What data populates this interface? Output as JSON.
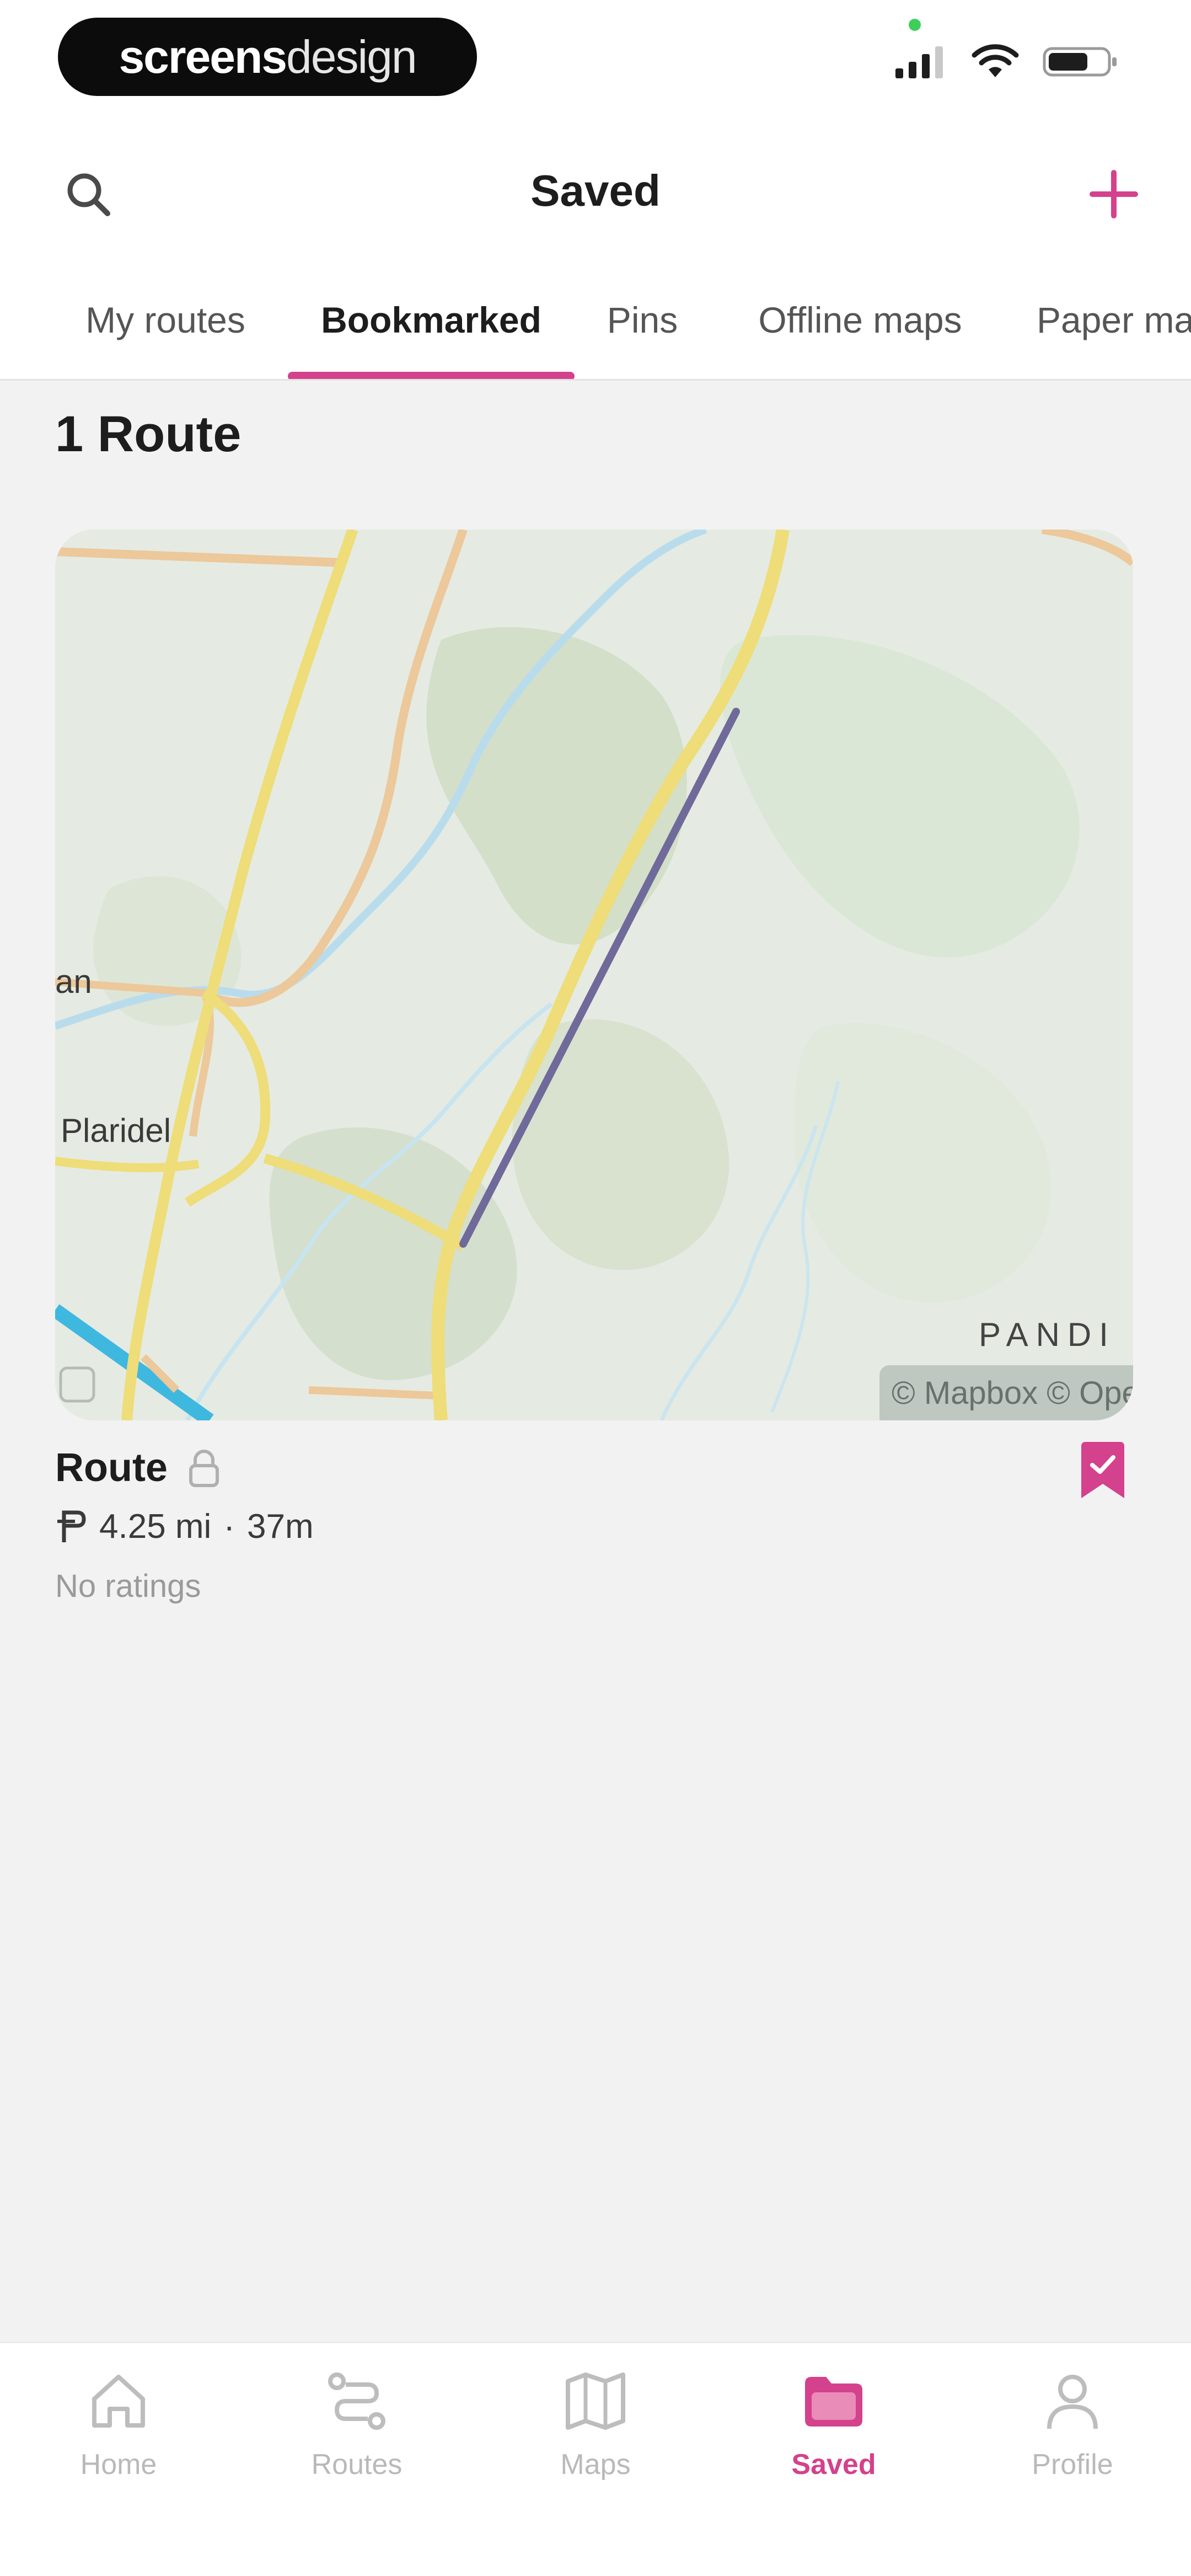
{
  "status_bar": {
    "brand_bold": "screens",
    "brand_light": "design"
  },
  "header": {
    "title": "Saved"
  },
  "tabs": [
    {
      "label": "My routes",
      "active": false
    },
    {
      "label": "Bookmarked",
      "active": true
    },
    {
      "label": "Pins",
      "active": false
    },
    {
      "label": "Offline maps",
      "active": false
    },
    {
      "label": "Paper maps",
      "active": false
    }
  ],
  "content": {
    "count_title": "1 Route",
    "route": {
      "name": "Route",
      "distance": "4.25 mi",
      "separator": "·",
      "duration": "37m",
      "ratings": "No ratings",
      "map": {
        "label_left": "an",
        "label_town": "Plaridel",
        "label_region": "PANDI",
        "attribution": "© Mapbox © OpenStreetMap"
      }
    }
  },
  "bottom_nav": [
    {
      "label": "Home",
      "icon": "home-icon",
      "active": false
    },
    {
      "label": "Routes",
      "icon": "routes-icon",
      "active": false
    },
    {
      "label": "Maps",
      "icon": "map-icon",
      "active": false
    },
    {
      "label": "Saved",
      "icon": "folder-icon",
      "active": true
    },
    {
      "label": "Profile",
      "icon": "person-icon",
      "active": false
    }
  ],
  "colors": {
    "accent": "#d4418c",
    "background": "#f2f2f2",
    "route_line": "#6f6a9a"
  }
}
